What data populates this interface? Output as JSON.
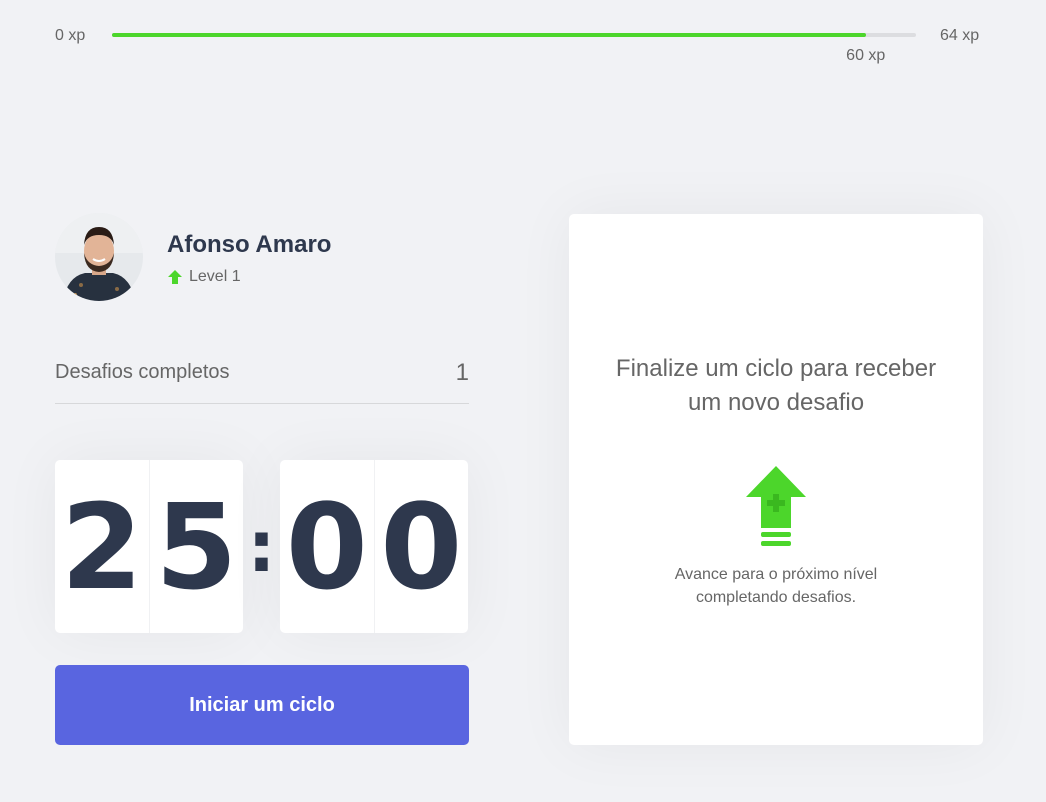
{
  "experience": {
    "min_label": "0 xp",
    "max_label": "64 xp",
    "current_label": "60 xp",
    "current": 60,
    "max": 64,
    "fill_color": "#4cd62b"
  },
  "profile": {
    "name": "Afonso Amaro",
    "level_label": "Level 1",
    "level_icon": "level-up-arrow-icon"
  },
  "completed_challenges": {
    "label": "Desafios completos",
    "count": "1"
  },
  "countdown": {
    "minute_left": "2",
    "minute_right": "5",
    "separator": ":",
    "second_left": "0",
    "second_right": "0"
  },
  "start_button": {
    "label": "Iniciar um ciclo",
    "color": "#5965e0"
  },
  "challenge_box": {
    "title": "Finalize um ciclo para receber um novo desafio",
    "icon": "level-up-icon",
    "description": "Avance para o próximo nível completando desafios."
  }
}
